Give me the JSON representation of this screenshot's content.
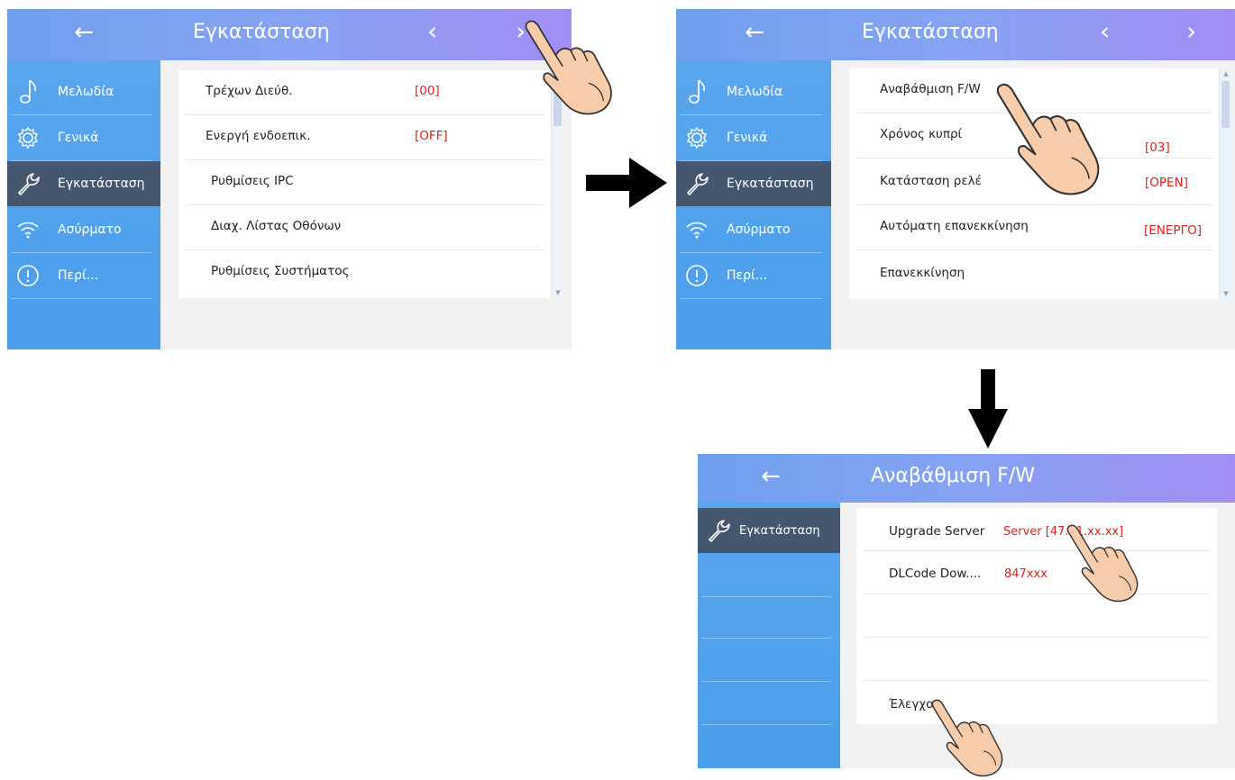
{
  "screens": [
    {
      "back_icon": "arrow-left-icon",
      "title": "Εγκατάσταση",
      "prev_icon": "chevron-left-icon",
      "next_icon": "chevron-right-icon",
      "sidebar": [
        {
          "icon": "music-note-icon",
          "label": "Μελωδία"
        },
        {
          "icon": "gear-icon",
          "label": "Γενικά"
        },
        {
          "icon": "wrench-icon",
          "label": "Εγκατάσταση"
        },
        {
          "icon": "wifi-icon",
          "label": "Ασύρματο"
        },
        {
          "icon": "info-icon",
          "label": "Περί..."
        }
      ],
      "rows": [
        {
          "label": "Τρέχων Διεύθ.",
          "value": "[00]"
        },
        {
          "label": "Ενεργή ενδοεπικ.",
          "value": "[OFF]"
        },
        {
          "label": "Ρυθμίσεις IPC",
          "value": ""
        },
        {
          "label": "Διαχ. Λίστας Οθόνων",
          "value": ""
        },
        {
          "label": "Ρυθμίσεις Συστήματος",
          "value": ""
        }
      ]
    },
    {
      "back_icon": "arrow-left-icon",
      "title": "Εγκατάσταση",
      "prev_icon": "chevron-left-icon",
      "next_icon": "chevron-right-icon",
      "sidebar": [
        {
          "icon": "music-note-icon",
          "label": "Μελωδία"
        },
        {
          "icon": "gear-icon",
          "label": "Γενικά"
        },
        {
          "icon": "wrench-icon",
          "label": "Εγκατάσταση"
        },
        {
          "icon": "wifi-icon",
          "label": "Ασύρματο"
        },
        {
          "icon": "info-icon",
          "label": "Περί..."
        }
      ],
      "rows": [
        {
          "label": "Αναβάθμιση F/W",
          "value": ""
        },
        {
          "label": "Χρόνος κυπρί",
          "value": "[03]"
        },
        {
          "label": "Κατάσταση ρελέ",
          "value": "[OPEN]"
        },
        {
          "label": "Αυτόματη επανεκκίνηση",
          "value": "[ΕΝΕΡΓΟ]"
        },
        {
          "label": "Επανεκκίνηση",
          "value": ""
        }
      ]
    },
    {
      "back_icon": "arrow-left-icon",
      "title": "Αναβάθμιση F/W",
      "sidebar": [
        {
          "icon": "wrench-icon",
          "label": "Εγκατάσταση"
        }
      ],
      "rows": [
        {
          "label": "Upgrade Server",
          "value": "Server [47.91.xx.xx]"
        },
        {
          "label": "DLCode Dow....",
          "value": "847xxx"
        },
        {
          "label": "",
          "value": ""
        },
        {
          "label": "",
          "value": ""
        },
        {
          "label": "Έλεγχος",
          "value": ""
        }
      ]
    }
  ],
  "flow_arrows": [
    "arrow-right-icon",
    "arrow-down-icon"
  ],
  "colors": {
    "value_red": "#e0201b",
    "sidebar_blue": "#4a9eec",
    "selected": "#45576f"
  }
}
